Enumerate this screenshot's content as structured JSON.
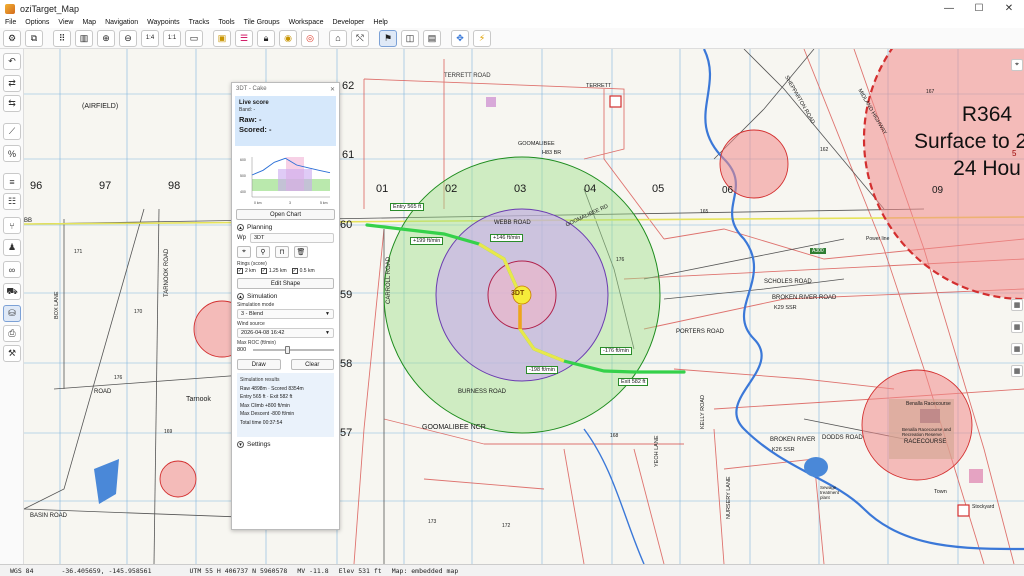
{
  "window": {
    "title": "oziTarget_Map",
    "controls": [
      "—",
      "☐",
      "✕"
    ]
  },
  "menu": [
    "File",
    "Options",
    "View",
    "Map",
    "Navigation",
    "Waypoints",
    "Tracks",
    "Tools",
    "Tile Groups",
    "Workspace",
    "Developer",
    "Help"
  ],
  "toolbar": {
    "zoom_label_1": "1:4",
    "zoom_label_2": "1:1"
  },
  "map": {
    "grid_labels": {
      "c96": "96",
      "c97": "97",
      "c98": "98",
      "c01": "01",
      "c02": "02",
      "c03": "03",
      "c04": "04",
      "c05": "05",
      "c06": "06",
      "c09": "09",
      "r62": "62",
      "r61": "61",
      "r60": "60",
      "r59": "59",
      "r58": "58",
      "r57": "57"
    },
    "place_labels": {
      "airfield": "(AIRFIELD)",
      "terrett_road": "TERRETT ROAD",
      "terrett": "TERRETT",
      "goomalibee": "GOOMALIBEE",
      "h83": "H83 BR",
      "webb_road": "WEBB ROAD",
      "goomalibee_rd": "GOOMALIBEE RD",
      "carroll_road": "CARROLL ROAD",
      "burness_road": "BURNESS ROAD",
      "goomalibee_ncr": "GOOMALIBEE NCR",
      "tarnook": "Tarnook",
      "tarnook_road": "TARNOOK ROAD",
      "basin_road": "BASIN ROAD",
      "scholes_road": "SCHOLES ROAD",
      "broken_river_road": "BROKEN RIVER ROAD",
      "k29": "K29 SSR",
      "porters_road": "PORTERS ROAD",
      "dodds_road": "DODDS ROAD",
      "broken_river": "BROKEN RIVER",
      "k26": "K26 SSR",
      "racecourse": "RACECOURSE",
      "benalla_race": "Benalla Racecourse",
      "benalla_reserve": "Benalla Racecourse and Recreation Reserve",
      "power_line": "Power line",
      "road_a300": "A300",
      "midland_hwy": "MIDLAND HIGHWAY",
      "shepparton": "SHEPPARTON ROAD",
      "box_lane": "BOX LANE",
      "nursery_lane": "NURSERY LANE",
      "yeoh_lane": "YEOH LANE",
      "kelly_road": "KELLY ROAD",
      "road": "ROAD",
      "sewage": "Sewage treatment plant",
      "stockyard": "Stockyard",
      "town": "Town",
      "bb": "BB",
      "r5": "5"
    },
    "airspace": {
      "line1": "R364",
      "line2": "Surface to 2",
      "line3": "24 Hou"
    },
    "target": "3DT",
    "track_labels": {
      "entry": "Entry 565 ft",
      "l1": "+199 ft/min",
      "l2": "+146 ft/min",
      "l3": "-198 ft/min",
      "l4": "-176 ft/min",
      "exit": "Exit 582 ft"
    },
    "spot_heights": [
      "162",
      "171",
      "170",
      "176",
      "169",
      "168",
      "173",
      "172",
      "176",
      "167",
      "165",
      "170",
      "161",
      "166",
      "169",
      "179",
      "182",
      "172",
      "173",
      "169",
      "163",
      "171"
    ]
  },
  "panel": {
    "title": "3DT - Cake",
    "close": "✕",
    "live_score": {
      "heading": "Live score",
      "band": "Band: -",
      "raw": "Raw: -",
      "scored": "Scored: -"
    },
    "chart_data": {
      "type": "area",
      "title": "",
      "x_ticks": [
        "0 km",
        "3",
        "5 km"
      ],
      "y_ticks": [
        "600",
        "500",
        "400"
      ],
      "altitude_profile": [
        565,
        600,
        660,
        690,
        640,
        620,
        600,
        582
      ],
      "bands": [
        "green",
        "purple"
      ]
    },
    "open_chart": "Open Chart",
    "planning": {
      "heading": "Planning",
      "wp_label": "Wp",
      "wp_value": "3DT",
      "icons": [
        "target-icon",
        "pin-icon",
        "lock-icon",
        "trash-icon"
      ],
      "rings_label": "Rings (score)",
      "rings": [
        "2 km",
        "1.25 km",
        "0.5 km"
      ],
      "edit_shape": "Edit Shape"
    },
    "simulation": {
      "heading": "Simulation",
      "mode_label": "Simulation mode",
      "mode_value": "3 - Blend",
      "wind_label": "Wind source",
      "wind_value": "2026-04-08 16:42",
      "roc_label": "Max ROC (ft/min)",
      "roc_value": "800",
      "draw": "Draw",
      "clear": "Clear"
    },
    "results": {
      "heading": "Simulation results",
      "raw": "Raw 4898m · Scored 8354m",
      "entry_exit": "Entry 565 ft · Exit 582 ft",
      "max_climb": "Max Climb +800 ft/min",
      "max_descent": "Max Descent -800 ft/min",
      "total_time": "Total time 00:37:54"
    },
    "settings": "Settings"
  },
  "statusbar": {
    "datum": "WGS 84",
    "latlon": "-36.405659, -145.958561",
    "utm": "UTM 55 H 406737 N 5960578",
    "mv": "MV -11.8",
    "elev": "Elev 531 ft",
    "map": "Map: embedded map"
  },
  "colors": {
    "green_ring": "#4caf50",
    "purple_ring": "#9c6ad9",
    "red_zone": "#e53935",
    "track_green": "#35d14a",
    "track_yellow": "#e8e84a",
    "track_orange": "#f2a21b",
    "score_bg": "#d6e8fb"
  }
}
